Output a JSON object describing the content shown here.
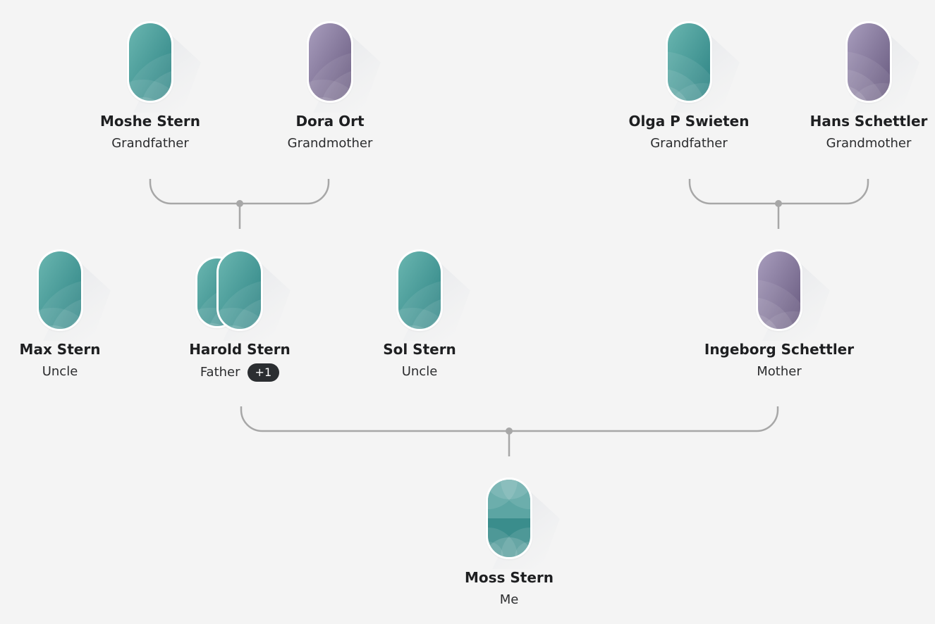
{
  "colors": {
    "background": "#f4f4f4",
    "connector": "#a7a7a7",
    "teal_top": "#67b3ad",
    "teal_bottom": "#2f8485",
    "purple_top": "#a59abb",
    "purple_bottom": "#6a5c80",
    "badge_bg": "#2b2e31"
  },
  "people": {
    "moshe": {
      "name": "Moshe Stern",
      "role": "Grandfather",
      "avatar": "teal-pattern-avatar"
    },
    "dora": {
      "name": "Dora Ort",
      "role": "Grandmother",
      "avatar": "purple-pattern-avatar"
    },
    "olga": {
      "name": "Olga P Swieten",
      "role": "Grandfather",
      "avatar": "teal-pattern-avatar"
    },
    "hans": {
      "name": "Hans Schettler",
      "role": "Grandmother",
      "avatar": "purple-pattern-avatar"
    },
    "max": {
      "name": "Max Stern",
      "role": "Uncle",
      "avatar": "teal-pattern-avatar"
    },
    "harold": {
      "name": "Harold Stern",
      "role": "Father",
      "badge": "+1",
      "avatar": "teal-pattern-avatar-stack"
    },
    "sol": {
      "name": "Sol Stern",
      "role": "Uncle",
      "avatar": "teal-pattern-avatar"
    },
    "ingeborg": {
      "name": "Ingeborg Schettler",
      "role": "Mother",
      "avatar": "purple-pattern-avatar"
    },
    "me": {
      "name": "Moss Stern",
      "role": "Me",
      "avatar": "teal-pattern-avatar-focus"
    }
  }
}
